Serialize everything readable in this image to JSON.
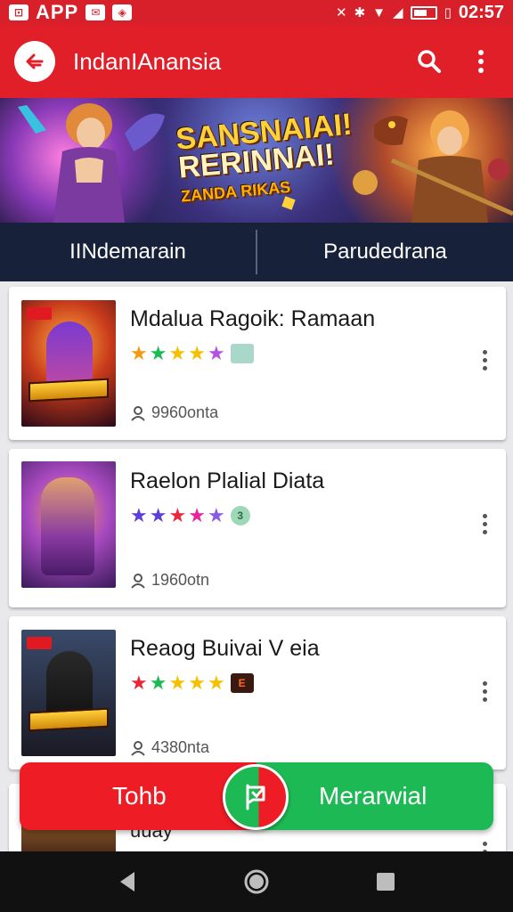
{
  "status_bar": {
    "app_label": "APP",
    "time": "02:57"
  },
  "app_bar": {
    "title": "IndanIAnansia"
  },
  "banner": {
    "title_line1": "SANSNAIAI!",
    "title_line2": "RERINNAI!",
    "title_line3": "ZANDA RIKAS"
  },
  "tabs": [
    {
      "label": "IINdemarain"
    },
    {
      "label": "Parudedrana"
    }
  ],
  "games": [
    {
      "title": "Mdalua Ragoik: Ramaan",
      "players": "9960onta",
      "stars": [
        {
          "glyph": "★",
          "color": "#f39a0e"
        },
        {
          "glyph": "★",
          "color": "#1db954"
        },
        {
          "glyph": "★",
          "color": "#f6c000"
        },
        {
          "glyph": "★",
          "color": "#f6c000"
        },
        {
          "glyph": "★",
          "color": "#b452e0"
        }
      ],
      "badge": "EX",
      "badge_bg": "#a9d7c9",
      "badge_fg": "#3a7a6a",
      "thumb_label": "GRANADJ"
    },
    {
      "title": "Raelon Plalial Diata",
      "players": "1960otn",
      "stars": [
        {
          "glyph": "★",
          "color": "#5b3fd6"
        },
        {
          "glyph": "★",
          "color": "#5b3fd6"
        },
        {
          "glyph": "★",
          "color": "#e8283a"
        },
        {
          "glyph": "★",
          "color": "#e5259c"
        },
        {
          "glyph": "★",
          "color": "#8a5ae0"
        }
      ],
      "badge": "3",
      "badge_bg": "#9ed8b6",
      "badge_fg": "#2a6a4a",
      "thumb_label": ""
    },
    {
      "title": "Reaog Buivai V eia",
      "players": "4380nta",
      "stars": [
        {
          "glyph": "★",
          "color": "#e8283a"
        },
        {
          "glyph": "★",
          "color": "#1db954"
        },
        {
          "glyph": "★",
          "color": "#f6c000"
        },
        {
          "glyph": "★",
          "color": "#f6c000"
        },
        {
          "glyph": "★",
          "color": "#f6c000"
        }
      ],
      "badge": "E",
      "badge_bg": "#3a1a10",
      "badge_fg": "#ff6a1a",
      "thumb_label": "DIAINOS"
    }
  ],
  "peek_card": {
    "text": "uuay"
  },
  "action_bar": {
    "left_label": "Tohb",
    "right_label": "Merarwial"
  },
  "colors": {
    "primary_red": "#e11f28",
    "status_red": "#d8202a",
    "tab_navy": "#17223a",
    "action_green": "#1db954",
    "action_red": "#ee1c24"
  }
}
